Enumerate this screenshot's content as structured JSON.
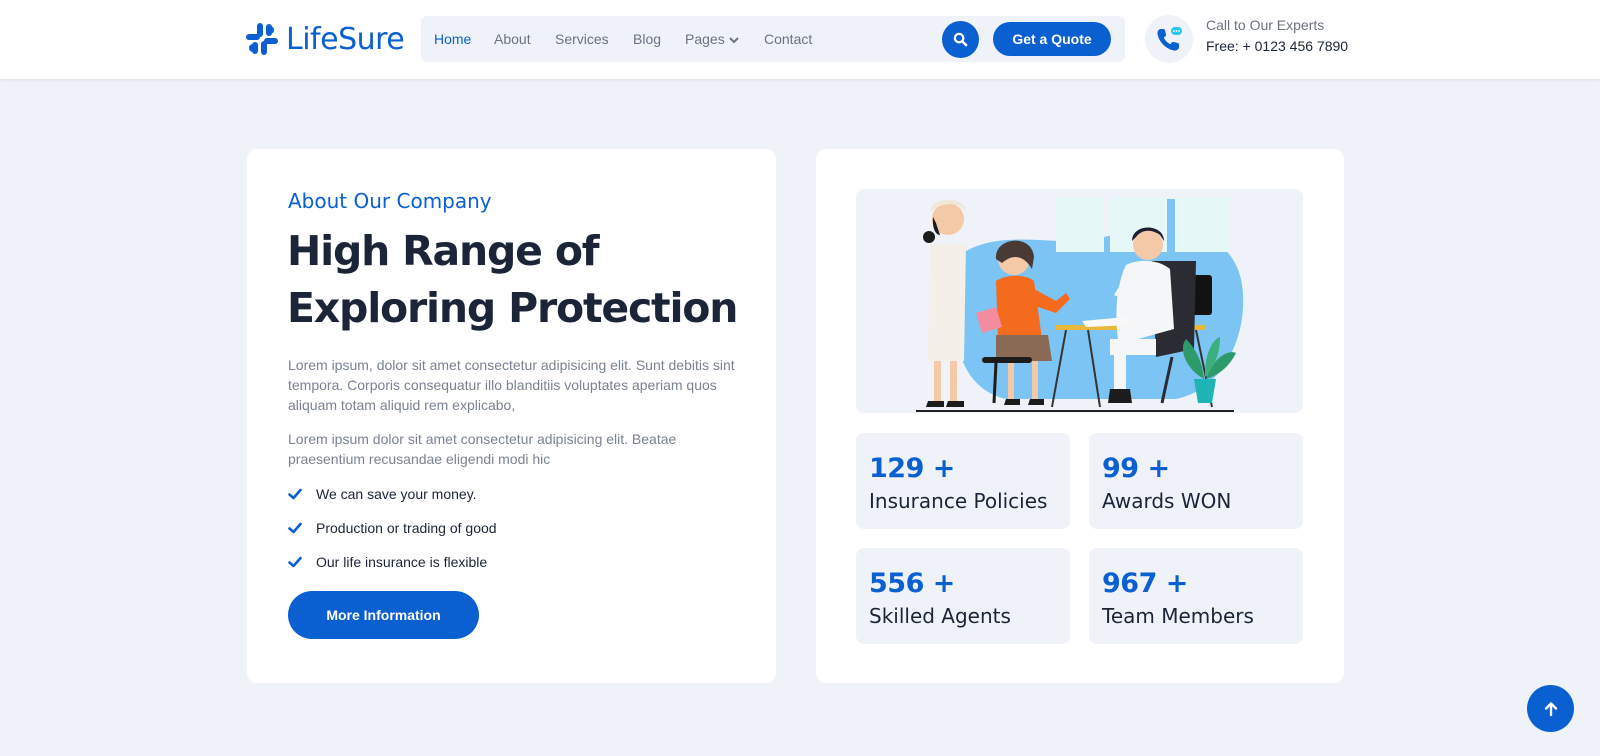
{
  "brand": {
    "name": "LifeSure",
    "icon": "logo-icon",
    "color": "#0a5fd1"
  },
  "nav": {
    "items": [
      {
        "label": "Home",
        "active": true
      },
      {
        "label": "About"
      },
      {
        "label": "Services"
      },
      {
        "label": "Blog"
      },
      {
        "label": "Pages",
        "dropdown": true
      },
      {
        "label": "Contact"
      }
    ],
    "search_icon": "search-icon",
    "quote_label": "Get a Quote"
  },
  "contact": {
    "icon": "phone-icon",
    "label": "Call to Our Experts",
    "number": "Free: + 0123 456 7890"
  },
  "about": {
    "eyebrow": "About Our Company",
    "headline_line1": "High Range of",
    "headline_line2": "Exploring Protection",
    "paragraph1": "Lorem ipsum, dolor sit amet consectetur adipisicing elit. Sunt debitis sint tempora. Corporis consequatur illo blanditiis voluptates aperiam quos aliquam totam aliquid rem explicabo,",
    "paragraph2": "Lorem ipsum dolor sit amet consectetur adipisicing elit. Beatae praesentium recusandae eligendi modi hic",
    "checks": [
      "We can save your money.",
      "Production or trading of good",
      "Our life insurance is flexible"
    ],
    "button_label": "More Information"
  },
  "stats": [
    {
      "number": "129 +",
      "label": "Insurance Policies"
    },
    {
      "number": "99 +",
      "label": "Awards WON"
    },
    {
      "number": "556 +",
      "label": "Skilled Agents"
    },
    {
      "number": "967 +",
      "label": "Team Members"
    }
  ],
  "illustration": "doctor-consultation-illustration",
  "scroll_top_icon": "arrow-up-icon",
  "colors": {
    "accent": "#0a5fd1",
    "background": "#eff3f9",
    "heading": "#1b2537",
    "muted": "#7a8291"
  }
}
